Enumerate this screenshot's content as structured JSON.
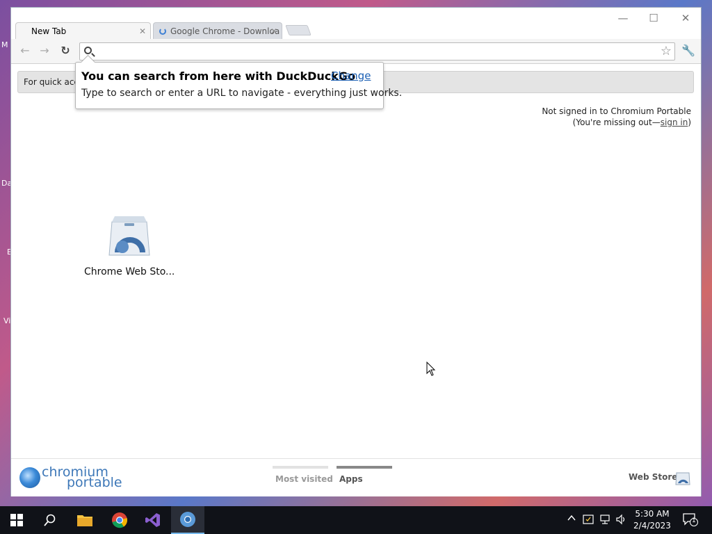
{
  "desktop": {
    "labels": [
      "M",
      "Da",
      "E",
      "Vi"
    ]
  },
  "window": {
    "controls": {
      "minimize": "—",
      "maximize": "☐",
      "close": "✕"
    }
  },
  "tabs": [
    {
      "title": "New Tab",
      "active": true
    },
    {
      "title": "Google Chrome - Downloa",
      "active": false,
      "loading": true
    }
  ],
  "tab_close_glyph": "✕",
  "toolbar": {
    "back": "←",
    "forward": "→",
    "reload": "↻",
    "omnibox_value": "",
    "star": "☆",
    "wrench": "🔧"
  },
  "infobar": {
    "text": "For quick acce"
  },
  "search_bubble": {
    "title": "You can search from here with DuckDuckGo",
    "change_link": "Change",
    "description": "Type to search or enter a URL to navigate - everything just works."
  },
  "signin": {
    "line1": "Not signed in to Chromium Portable",
    "line2_prefix": "(You're missing out—",
    "link": "sign in",
    "line2_suffix": ")"
  },
  "apps": [
    {
      "label": "Chrome Web Sto..."
    }
  ],
  "footer": {
    "logo_line1": "chromium",
    "logo_line2": "portable",
    "tabs": [
      {
        "label": "Most visited",
        "selected": false
      },
      {
        "label": "Apps",
        "selected": true
      }
    ],
    "web_store_label": "Web Store"
  },
  "taskbar": {
    "clock_time": "5:30 AM",
    "clock_date": "2/4/2023",
    "notification_count": "1"
  },
  "colors": {
    "accent_link": "#1a5fb4",
    "logo_blue": "#3e78b8",
    "taskbar_bg": "#101218"
  }
}
